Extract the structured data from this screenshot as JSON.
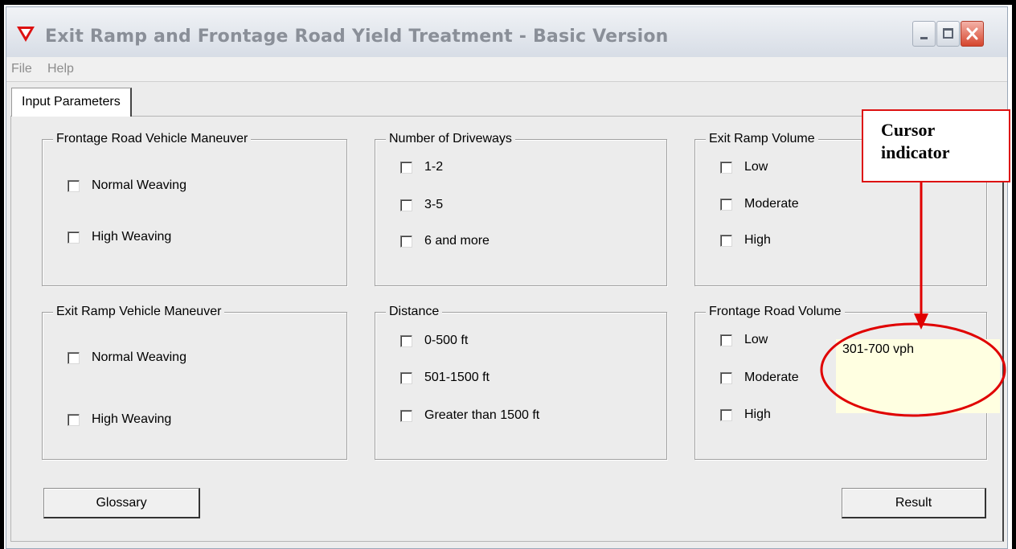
{
  "window": {
    "title": "Exit Ramp and Frontage Road Yield Treatment - Basic Version",
    "icon": "red-triangle-icon",
    "caption_buttons": [
      "minimize-icon",
      "maximize-icon",
      "close-icon"
    ]
  },
  "menu": [
    "File",
    "Help"
  ],
  "tabs": [
    {
      "label": "Input Parameters",
      "selected": true
    }
  ],
  "groups": {
    "frontage_maneuver": {
      "title": "Frontage Road Vehicle Maneuver",
      "options": [
        "Normal Weaving",
        "High Weaving"
      ]
    },
    "driveways": {
      "title": "Number of Driveways",
      "options": [
        "1-2",
        "3-5",
        "6 and more"
      ]
    },
    "exit_volume": {
      "title": "Exit Ramp Volume",
      "options": [
        "Low",
        "Moderate",
        "High"
      ]
    },
    "exit_maneuver": {
      "title": "Exit Ramp Vehicle Maneuver",
      "options": [
        "Normal Weaving",
        "High Weaving"
      ]
    },
    "distance": {
      "title": "Distance",
      "options": [
        "0-500 ft",
        "501-1500 ft",
        "Greater than 1500 ft"
      ]
    },
    "frontage_volume": {
      "title": "Frontage Road Volume",
      "options": [
        "Low",
        "Moderate",
        "High"
      ]
    }
  },
  "buttons": {
    "glossary": "Glossary",
    "result": "Result"
  },
  "tooltip": "301-700 vph",
  "annotation": {
    "line1": "Cursor",
    "line2": "indicator",
    "color": "#e00000"
  },
  "colors": {
    "tooltip_bg": "#ffffe1",
    "dialog_bg": "#ececec",
    "annotation": "#e00000"
  }
}
